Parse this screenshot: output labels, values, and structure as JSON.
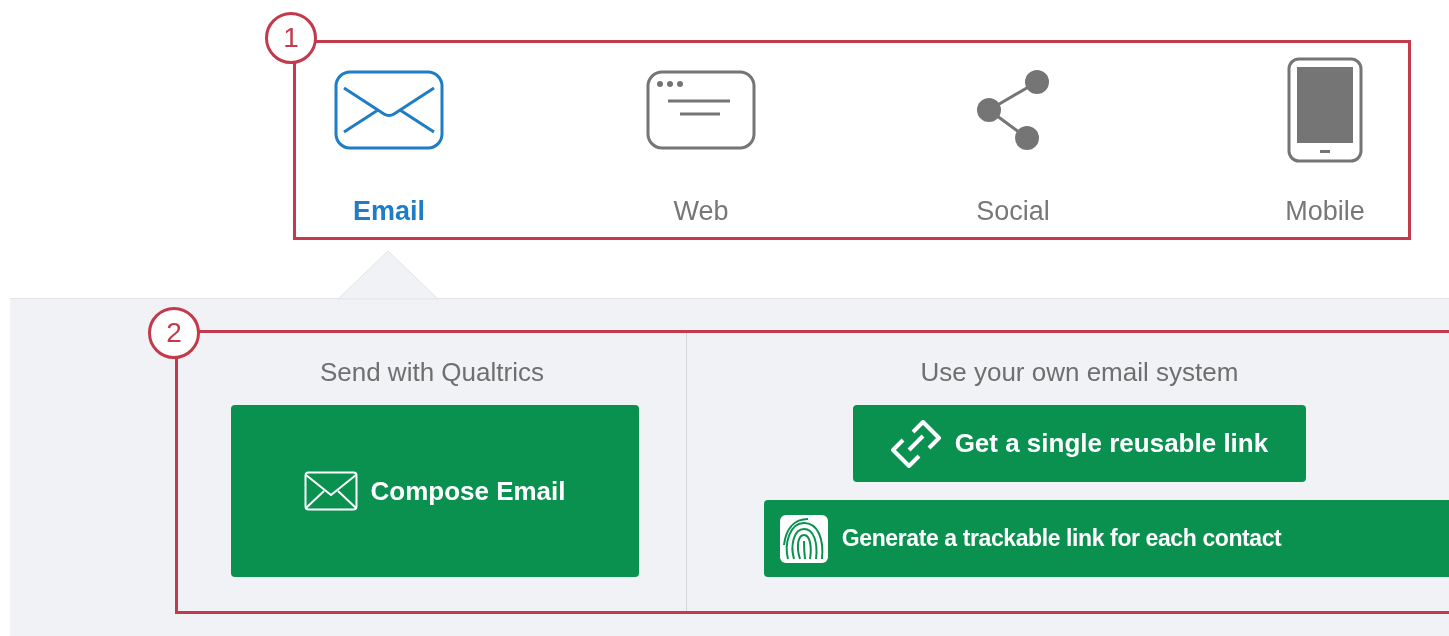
{
  "channel_tabs": {
    "callout": "1",
    "tabs": [
      {
        "label": "Email",
        "selected": true
      },
      {
        "label": "Web",
        "selected": false
      },
      {
        "label": "Social",
        "selected": false
      },
      {
        "label": "Mobile",
        "selected": false
      }
    ]
  },
  "email_panel": {
    "callout": "2",
    "sections": [
      {
        "heading": "Send with Qualtrics",
        "buttons": [
          {
            "label": "Compose Email"
          }
        ]
      },
      {
        "heading": "Use your own email system",
        "buttons": [
          {
            "label": "Get a single reusable link"
          },
          {
            "label": "Generate a trackable link for each contact"
          }
        ]
      }
    ]
  }
}
